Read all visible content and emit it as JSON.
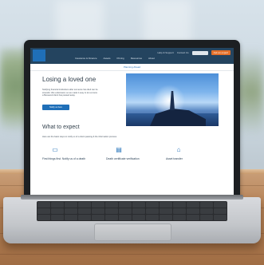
{
  "site": {
    "logo_text": "",
    "nav": [
      "Insurance & Finance",
      "Assets",
      "Pricing",
      "Resources",
      "About"
    ],
    "top_links": [
      "Help & Support",
      "Contact Us"
    ],
    "ask_button": "Ask an expert",
    "breadcrumb": "Planning Ahead",
    "hero": {
      "title": "Losing a loved one",
      "text": "Notifying financial institutions after someone has died can be stressful. We understand, so we made it easy to let us know a Bereaved client has passed away.",
      "button": "Notify us here"
    },
    "section": {
      "title": "What to expect",
      "text": "Here are the basic steps to notify us of a client passing & the information process."
    },
    "cards": [
      {
        "icon": "monitor-icon",
        "title": "First things first. Notify us of a death"
      },
      {
        "icon": "document-icon",
        "title": "Death certificate verification"
      },
      {
        "icon": "bank-icon",
        "title": "Asset transfer"
      }
    ]
  },
  "colors": {
    "header": "#24445f",
    "accent_blue": "#1f6fb8",
    "accent_orange": "#e4702a"
  }
}
